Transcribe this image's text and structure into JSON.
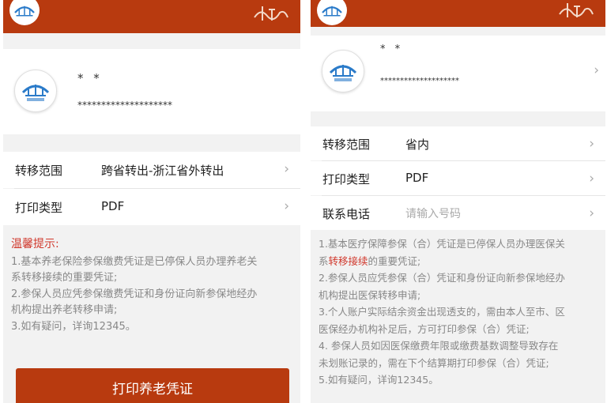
{
  "left": {
    "profile": {
      "name": "* *",
      "id_masked": "********************"
    },
    "rows": [
      {
        "label": "转移范围",
        "value": "跨省转出-浙江省外转出"
      },
      {
        "label": "打印类型",
        "value": "PDF"
      }
    ],
    "notice": {
      "title": "温馨提示:",
      "lines": [
        "1.基本养老保险参保缴费凭证是已停保人员办理养老关",
        "系转移接续的重要凭证;",
        "2.参保人员应凭参保缴费凭证和身份证向新参保地经办",
        "机构提出养老转移申请;",
        "3.如有疑问，详询12345。"
      ]
    },
    "button_label": "打印养老凭证"
  },
  "right": {
    "profile": {
      "name": "* *",
      "id_masked": "********************"
    },
    "rows": [
      {
        "label": "转移范围",
        "value": "省内"
      },
      {
        "label": "打印类型",
        "value": "PDF"
      },
      {
        "label": "联系电话",
        "placeholder": "请输入号码"
      }
    ],
    "notice": {
      "line1_prefix": "1.基本医疗保障参保（合）凭证是已停保人员办理医保关",
      "line2_prefix": "系",
      "line2_highlight": "转移接续",
      "line2_suffix": "的重要凭证;",
      "lines": [
        "2.参保人员应凭参保（合）凭证和身份证向新参保地经办",
        "机构提出医保转移申请;",
        "3.个人账户实际结余资金出现透支的，需由本人至市、区",
        "医保经办机构补足后，方可打印参保（合）凭证;",
        "4. 参保人员如因医保缴费年限或缴费基数调整导致存在",
        "未划账记录的，需在下个结算期打印参保（合）凭证;",
        "5.如有疑问，详询12345。"
      ]
    }
  },
  "icons": {
    "logo": "hangzhou-hrss-logo-icon",
    "brand": "hangzhou-calligraphy-icon",
    "chevron": "chevron-right-icon"
  },
  "colors": {
    "brand": "#b83a0f",
    "highlight": "#d0372b",
    "muted": "#888888"
  }
}
